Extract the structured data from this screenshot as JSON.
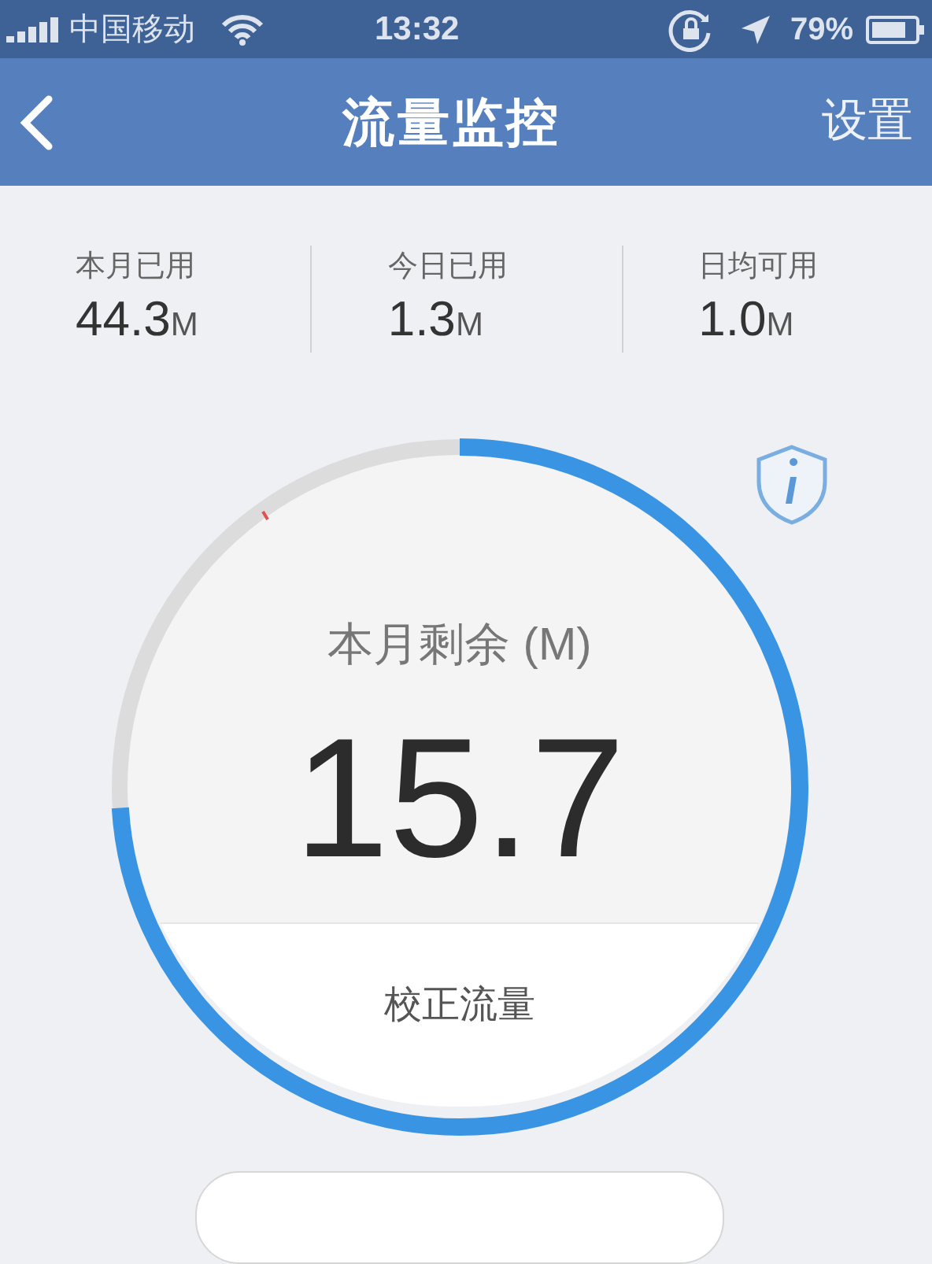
{
  "status_bar": {
    "carrier": "中国移动",
    "time": "13:32",
    "battery": "79%"
  },
  "nav": {
    "title": "流量监控",
    "right": "设置"
  },
  "stats": [
    {
      "label": "本月已用",
      "value": "44.3",
      "unit": "M"
    },
    {
      "label": "今日已用",
      "value": "1.3",
      "unit": "M"
    },
    {
      "label": "日均可用",
      "value": "1.0",
      "unit": "M"
    }
  ],
  "gauge": {
    "label": "本月剩余",
    "unit": "(M)",
    "value": "15.7",
    "button": "校正流量"
  }
}
